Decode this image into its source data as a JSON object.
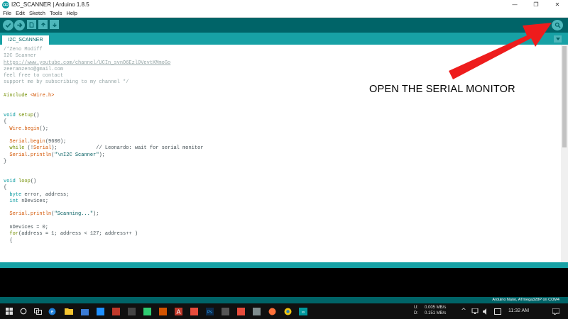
{
  "window": {
    "title": "I2C_SCANNER | Arduino 1.8.5",
    "controls": {
      "minimize": "—",
      "maximize": "❐",
      "close": "✕"
    }
  },
  "menu": [
    "File",
    "Edit",
    "Sketch",
    "Tools",
    "Help"
  ],
  "toolbar": {
    "buttons": [
      "verify-icon",
      "upload-icon",
      "new-icon",
      "open-icon",
      "save-icon"
    ],
    "serial_monitor": "serial-monitor-icon"
  },
  "tabs": {
    "active": "I2C_SCANNER",
    "menu_glyph": "▼"
  },
  "code_lines": [
    [
      {
        "t": "/*Zeno Modiff",
        "c": "comment"
      }
    ],
    [
      {
        "t": "I2C Scanner",
        "c": "comment"
      }
    ],
    [
      {
        "t": "https://www.youtube.com/channel/UCIn_svnO6Ezl0VevtKMmoGo",
        "c": "link"
      }
    ],
    [
      {
        "t": "zeeramzeno@gmail.com",
        "c": "comment"
      }
    ],
    [
      {
        "t": "feel free to contact",
        "c": "comment"
      }
    ],
    [
      {
        "t": "support me by subscribing to my channel */",
        "c": "comment"
      }
    ],
    [],
    [
      {
        "t": "#include ",
        "c": "kw"
      },
      {
        "t": "<Wire.h>",
        "c": "fn"
      }
    ],
    [],
    [],
    [
      {
        "t": "void",
        "c": "type"
      },
      {
        "t": " ",
        "c": "plain"
      },
      {
        "t": "setup",
        "c": "kw"
      },
      {
        "t": "()",
        "c": "plain"
      }
    ],
    [
      {
        "t": "{",
        "c": "plain"
      }
    ],
    [
      {
        "t": "  ",
        "c": "plain"
      },
      {
        "t": "Wire",
        "c": "fn"
      },
      {
        "t": ".",
        "c": "plain"
      },
      {
        "t": "begin",
        "c": "fn"
      },
      {
        "t": "();",
        "c": "plain"
      }
    ],
    [],
    [
      {
        "t": "  ",
        "c": "plain"
      },
      {
        "t": "Serial",
        "c": "fn"
      },
      {
        "t": ".",
        "c": "plain"
      },
      {
        "t": "begin",
        "c": "fn"
      },
      {
        "t": "(9600);",
        "c": "plain"
      }
    ],
    [
      {
        "t": "  ",
        "c": "plain"
      },
      {
        "t": "while",
        "c": "kw"
      },
      {
        "t": " (!",
        "c": "plain"
      },
      {
        "t": "Serial",
        "c": "fn"
      },
      {
        "t": ");             // Leonardo: wait for serial monitor",
        "c": "plain"
      }
    ],
    [
      {
        "t": "  ",
        "c": "plain"
      },
      {
        "t": "Serial",
        "c": "fn"
      },
      {
        "t": ".",
        "c": "plain"
      },
      {
        "t": "println",
        "c": "fn"
      },
      {
        "t": "(",
        "c": "plain"
      },
      {
        "t": "\"\\nI2C Scanner\"",
        "c": "str"
      },
      {
        "t": ");",
        "c": "plain"
      }
    ],
    [
      {
        "t": "}",
        "c": "plain"
      }
    ],
    [],
    [],
    [
      {
        "t": "void",
        "c": "type"
      },
      {
        "t": " ",
        "c": "plain"
      },
      {
        "t": "loop",
        "c": "kw"
      },
      {
        "t": "()",
        "c": "plain"
      }
    ],
    [
      {
        "t": "{",
        "c": "plain"
      }
    ],
    [
      {
        "t": "  ",
        "c": "plain"
      },
      {
        "t": "byte",
        "c": "type"
      },
      {
        "t": " error, address;",
        "c": "plain"
      }
    ],
    [
      {
        "t": "  ",
        "c": "plain"
      },
      {
        "t": "int",
        "c": "type"
      },
      {
        "t": " nDevices;",
        "c": "plain"
      }
    ],
    [],
    [
      {
        "t": "  ",
        "c": "plain"
      },
      {
        "t": "Serial",
        "c": "fn"
      },
      {
        "t": ".",
        "c": "plain"
      },
      {
        "t": "println",
        "c": "fn"
      },
      {
        "t": "(",
        "c": "plain"
      },
      {
        "t": "\"Scanning...\"",
        "c": "str"
      },
      {
        "t": ");",
        "c": "plain"
      }
    ],
    [],
    [
      {
        "t": "  nDevices = 0;",
        "c": "plain"
      }
    ],
    [
      {
        "t": "  ",
        "c": "plain"
      },
      {
        "t": "for",
        "c": "kw"
      },
      {
        "t": "(address = 1; address < 127; address++ )",
        "c": "plain"
      }
    ],
    [
      {
        "t": "  {",
        "c": "plain"
      }
    ]
  ],
  "code_colors": {
    "comment": "#95a5a6",
    "keyword": "#728e00",
    "function": "#d35400",
    "type": "#00979c",
    "string": "#005c5f"
  },
  "annotation": "OPEN THE SERIAL MONITOR",
  "arrow_color": "#ee1c1c",
  "status": {
    "board": "Arduino Nano, ATmega328P on COM4"
  },
  "taskbar": {
    "net_up_label": "U:",
    "net_up": "0.005 MB/s",
    "net_down_label": "D:",
    "net_down": "0.151 MB/s",
    "time": "11:32 AM"
  },
  "colors": {
    "toolbar": "#006468",
    "tabbar": "#17a1a5",
    "button": "#4db7bb"
  }
}
